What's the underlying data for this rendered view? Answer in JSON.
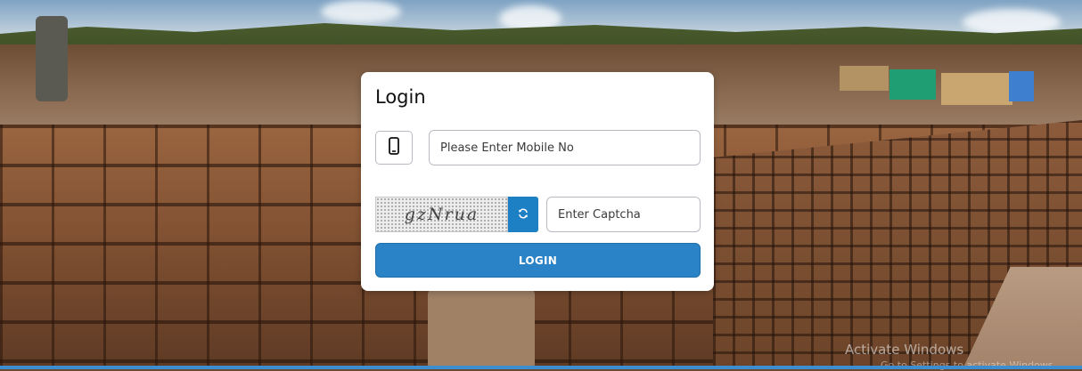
{
  "login": {
    "title": "Login",
    "mobile": {
      "icon": "mobile-phone-icon",
      "placeholder": "Please Enter Mobile No",
      "value": ""
    },
    "captcha": {
      "image_text": "gzNrua",
      "refresh_icon": "refresh-icon",
      "placeholder": "Enter Captcha",
      "value": ""
    },
    "submit_label": "LOGIN"
  },
  "os_watermark": {
    "title": "Activate Windows",
    "subtitle": "Go to Settings to activate Windows."
  },
  "colors": {
    "primary_button": "#2a83c6",
    "refresh_button": "#1d7fc4",
    "card_background": "#ffffff",
    "bottom_bar": "#3c8ed0"
  }
}
